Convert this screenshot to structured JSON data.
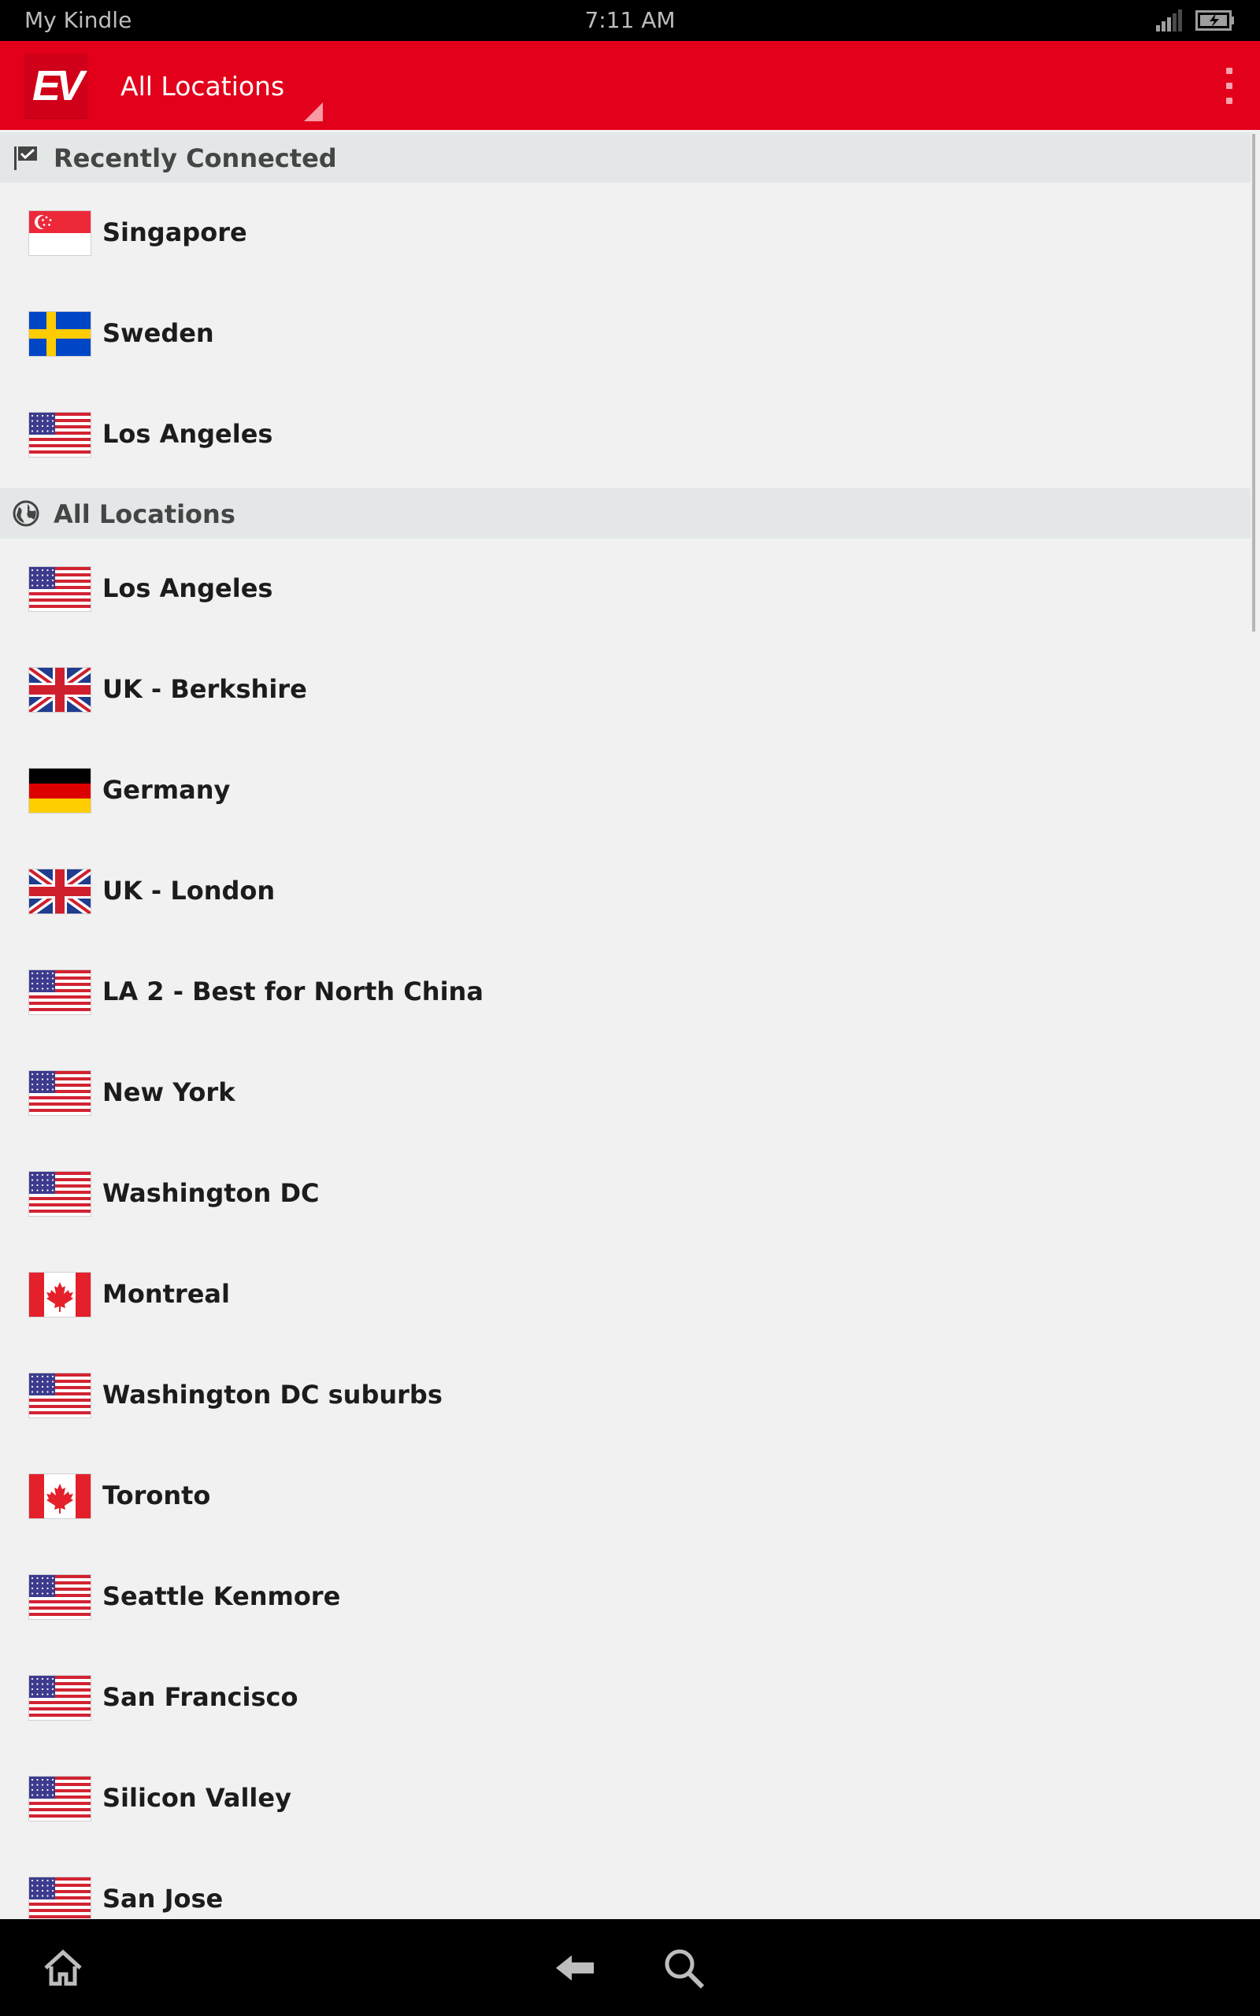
{
  "status_bar": {
    "device_name": "My Kindle",
    "time": "7:11 AM"
  },
  "action_bar": {
    "logo_text": "EV",
    "title": "All Locations"
  },
  "recent_header": "Recently Connected",
  "recent": [
    {
      "name": "Singapore",
      "flag": "sg"
    },
    {
      "name": "Sweden",
      "flag": "se"
    },
    {
      "name": "Los Angeles",
      "flag": "us"
    }
  ],
  "all_header": "All Locations",
  "locations": [
    {
      "name": "Los Angeles",
      "flag": "us"
    },
    {
      "name": "UK - Berkshire",
      "flag": "gb"
    },
    {
      "name": "Germany",
      "flag": "de"
    },
    {
      "name": "UK - London",
      "flag": "gb"
    },
    {
      "name": "LA 2 - Best for North China",
      "flag": "us"
    },
    {
      "name": "New York",
      "flag": "us"
    },
    {
      "name": "Washington DC",
      "flag": "us"
    },
    {
      "name": "Montreal",
      "flag": "ca"
    },
    {
      "name": "Washington DC suburbs",
      "flag": "us"
    },
    {
      "name": "Toronto",
      "flag": "ca"
    },
    {
      "name": "Seattle Kenmore",
      "flag": "us"
    },
    {
      "name": "San Francisco",
      "flag": "us"
    },
    {
      "name": "Silicon Valley",
      "flag": "us"
    },
    {
      "name": "San Jose",
      "flag": "us"
    }
  ],
  "colors": {
    "accent": "#e2001b",
    "header_bg": "#e3e7e8",
    "list_bg": "#f1f1f1"
  },
  "icons": [
    "signal-icon",
    "battery-icon",
    "overflow-menu-icon",
    "recent-flag-icon",
    "globe-icon",
    "home-icon",
    "back-icon",
    "search-icon"
  ]
}
